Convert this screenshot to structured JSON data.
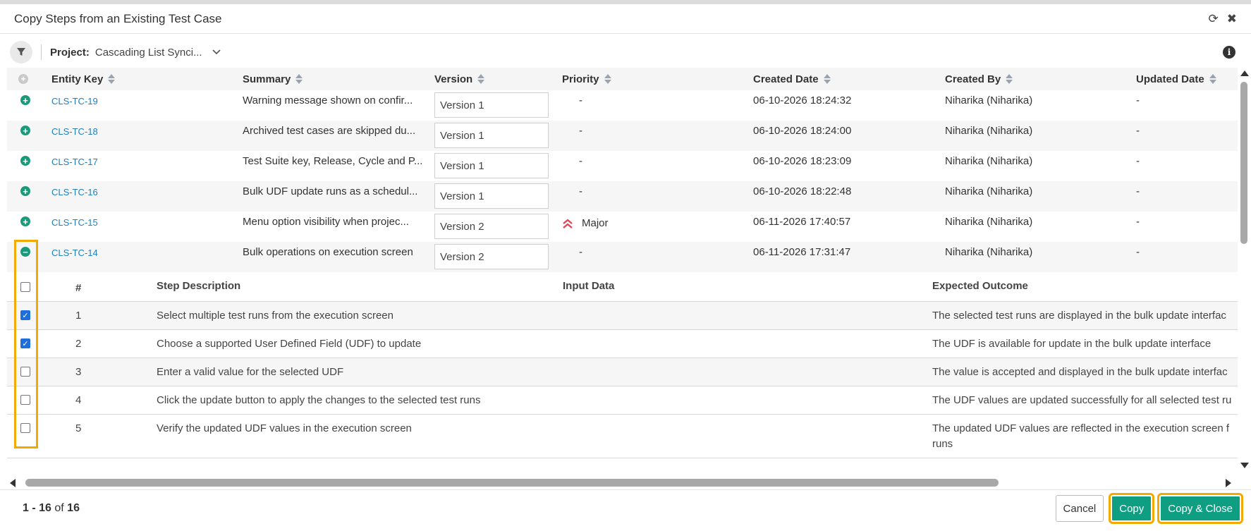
{
  "dialog": {
    "title": "Copy Steps from an Existing Test Case"
  },
  "filter": {
    "project_label": "Project:",
    "project_value": "Cascading List Synci..."
  },
  "columns": {
    "entity_key": "Entity Key",
    "summary": "Summary",
    "version": "Version",
    "priority": "Priority",
    "created_date": "Created Date",
    "created_by": "Created By",
    "updated_date": "Updated Date"
  },
  "rows": [
    {
      "key": "CLS-TC-19",
      "summary": "Warning message shown on confir...",
      "version": "Version 1",
      "priority": "-",
      "created_date": "06-10-2026 18:24:32",
      "created_by": "Niharika (Niharika)",
      "updated_date": "-"
    },
    {
      "key": "CLS-TC-18",
      "summary": "Archived test cases are skipped du...",
      "version": "Version 1",
      "priority": "-",
      "created_date": "06-10-2026 18:24:00",
      "created_by": "Niharika (Niharika)",
      "updated_date": "-"
    },
    {
      "key": "CLS-TC-17",
      "summary": "Test Suite key, Release, Cycle and P...",
      "version": "Version 1",
      "priority": "-",
      "created_date": "06-10-2026 18:23:09",
      "created_by": "Niharika (Niharika)",
      "updated_date": "-"
    },
    {
      "key": "CLS-TC-16",
      "summary": "Bulk UDF update runs as a schedul...",
      "version": "Version 1",
      "priority": "-",
      "created_date": "06-10-2026 18:22:48",
      "created_by": "Niharika (Niharika)",
      "updated_date": "-"
    },
    {
      "key": "CLS-TC-15",
      "summary": "Menu option visibility when projec...",
      "version": "Version 2",
      "priority": "Major",
      "created_date": "06-11-2026 17:40:57",
      "created_by": "Niharika (Niharika)",
      "updated_date": "-"
    },
    {
      "key": "CLS-TC-14",
      "summary": "Bulk operations on execution screen",
      "version": "Version 2",
      "priority": "-",
      "created_date": "06-11-2026 17:31:47",
      "created_by": "Niharika (Niharika)",
      "updated_date": "-"
    }
  ],
  "steps": {
    "headers": {
      "number": "#",
      "description": "Step Description",
      "input": "Input Data",
      "outcome": "Expected Outcome"
    },
    "items": [
      {
        "n": "1",
        "description": "Select multiple test runs from the execution screen",
        "input": "",
        "outcome": "The selected test runs are displayed in the bulk update interfac",
        "checked": true
      },
      {
        "n": "2",
        "description": "Choose a supported User Defined Field (UDF) to update",
        "input": "",
        "outcome": "The UDF is available for update in the bulk update interface",
        "checked": true
      },
      {
        "n": "3",
        "description": "Enter a valid value for the selected UDF",
        "input": "",
        "outcome": "The value is accepted and displayed in the bulk update interfac",
        "checked": false
      },
      {
        "n": "4",
        "description": "Click the update button to apply the changes to the selected test runs",
        "input": "",
        "outcome": "The UDF values are updated successfully for all selected test ru",
        "checked": false
      },
      {
        "n": "5",
        "description": "Verify the updated UDF values in the execution screen",
        "input": "",
        "outcome": "The updated UDF values are reflected in the execution screen f",
        "outcome2": "runs",
        "checked": false
      }
    ]
  },
  "footer": {
    "range": "1 - 16",
    "of": "of",
    "total": "16",
    "cancel": "Cancel",
    "copy": "Copy",
    "copy_close": "Copy & Close"
  },
  "colors": {
    "accent": "#0e9f83",
    "link": "#1f7fbf",
    "highlight": "#f2a900",
    "priority_major": "#e0455a"
  }
}
